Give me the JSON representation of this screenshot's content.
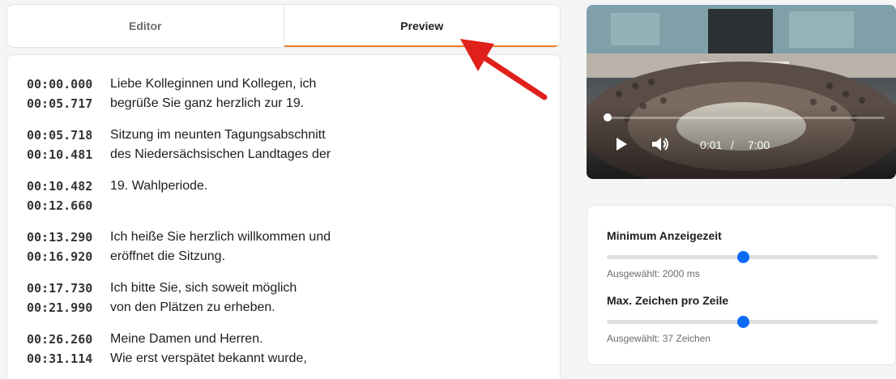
{
  "tabs": [
    {
      "label": "Editor",
      "active": false
    },
    {
      "label": "Preview",
      "active": true
    }
  ],
  "transcript": [
    {
      "start": "00:00.000",
      "end": "00:05.717",
      "lines": [
        "Liebe Kolleginnen und Kollegen, ich",
        "begrüße Sie ganz herzlich zur 19."
      ]
    },
    {
      "start": "00:05.718",
      "end": "00:10.481",
      "lines": [
        "Sitzung im neunten Tagungsabschnitt",
        "des Niedersächsischen Landtages der"
      ]
    },
    {
      "start": "00:10.482",
      "end": "00:12.660",
      "lines": [
        "19. Wahlperiode.",
        ""
      ]
    },
    {
      "start": "00:13.290",
      "end": "00:16.920",
      "lines": [
        "Ich heiße Sie herzlich willkommen und",
        "eröffnet die Sitzung."
      ]
    },
    {
      "start": "00:17.730",
      "end": "00:21.990",
      "lines": [
        "Ich bitte Sie, sich soweit möglich",
        "von den Plätzen zu erheben."
      ]
    },
    {
      "start": "00:26.260",
      "end": "00:31.114",
      "lines": [
        "Meine Damen und Herren.",
        "Wie erst verspätet bekannt wurde,"
      ]
    }
  ],
  "video": {
    "current_time": "0:01",
    "separator": "/",
    "duration": "7:00",
    "progress": 0.0024
  },
  "settings": {
    "min_display": {
      "title": "Minimum Anzeigezeit",
      "note": "Ausgewählt: 2000 ms",
      "value_fraction": 0.5
    },
    "max_chars": {
      "title": "Max. Zeichen pro Zeile",
      "note": "Ausgewählt: 37 Zeichen",
      "value_fraction": 0.5
    }
  },
  "colors": {
    "accent_tab": "#f47a2a",
    "slider_thumb": "#0b6bf6",
    "arrow": "#e0201b"
  }
}
